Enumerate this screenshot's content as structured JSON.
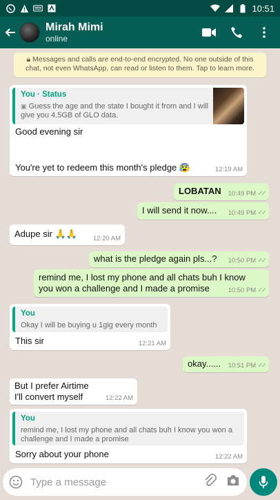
{
  "statusbar": {
    "time": "10:51"
  },
  "header": {
    "title": "Mirah Mimi",
    "subtitle": "online"
  },
  "notice": {
    "text": "Messages and calls are end-to-end encrypted. No one outside of this chat, not even WhatsApp, can read or listen to them. Tap to learn more."
  },
  "messages": [
    {
      "dir": "in",
      "quote_name": "You · Status",
      "quote_text": "Guess the age and the state I bought it from and I will give you 4.5GB of GLO data.",
      "line1": "Good evening sir",
      "line2": "You're yet to redeem this month's pledge 😰",
      "time": "12:19 AM"
    },
    {
      "dir": "out",
      "text": "LOBATAN",
      "time": "10:49 PM"
    },
    {
      "dir": "out",
      "text": "I will send it now....",
      "time": "10:49 PM"
    },
    {
      "dir": "in",
      "text": "Adupe sir 🙏🙏",
      "time": "12:20 AM"
    },
    {
      "dir": "out",
      "text": "what is the pledge again pls...?",
      "time": "10:50 PM"
    },
    {
      "dir": "out",
      "text": "remind me, I lost my phone and all chats buh I know you won a challenge and I made a promise",
      "time": "10:50 PM"
    },
    {
      "dir": "in",
      "quote_name": "You",
      "quote_text": "Okay I will be buying u 1gig every month",
      "text": "This sir",
      "time": "12:21 AM"
    },
    {
      "dir": "out",
      "text": "okay......",
      "time": "10:51 PM"
    },
    {
      "dir": "in",
      "text": "But I prefer Airtime\nI'll convert myself",
      "time": "12:22 AM"
    },
    {
      "dir": "in",
      "quote_name": "You",
      "quote_text": "remind me, I lost my phone and all chats buh I know you won a challenge and I made a promise",
      "text": "Sorry about your phone",
      "time": "12:22 AM"
    }
  ],
  "composer": {
    "placeholder": "Type a message"
  },
  "colors": {
    "header": "#075e54",
    "statusbar": "#054d44",
    "outgoing": "#dcf8c6",
    "incoming": "#ffffff",
    "accent": "#00897b",
    "background": "#e5ddd5"
  }
}
